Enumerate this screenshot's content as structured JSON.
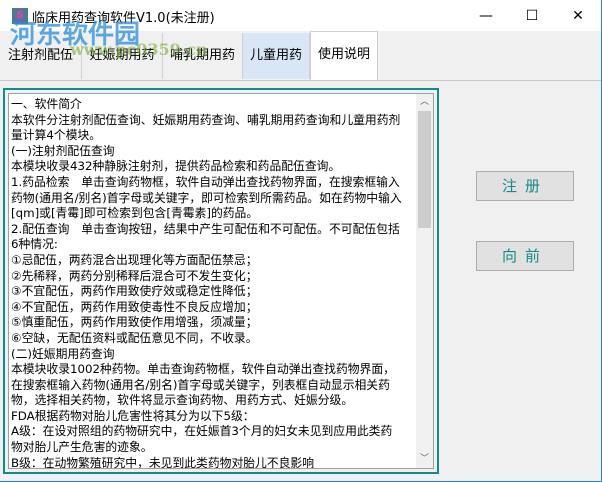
{
  "window": {
    "title": "临床用药查询软件V1.0(未注册)",
    "controls": {
      "minimize": "—",
      "maximize": "☐",
      "close": "✕"
    },
    "icon_letter": "S"
  },
  "tabs": [
    {
      "label": "注射剂配伍"
    },
    {
      "label": "妊娠期用药"
    },
    {
      "label": "哺乳期用药"
    },
    {
      "label": "儿童用药"
    },
    {
      "label": "使用说明"
    }
  ],
  "content": {
    "lines": [
      "一、软件简介",
      "本软件分注射剂配伍查询、妊娠期用药查询、哺乳期用药查询和儿童用药剂",
      "量计算4个模块。",
      "(一)注射剂配伍查询",
      "本模块收录432种静脉注射剂，提供药品检索和药品配伍查询。",
      "1.药品检索　单击查询药物框，软件自动弹出查找药物界面，在搜索框输入",
      "药物(通用名/别名)首字母或关键字，即可检索到所需药品。如在药物中输入",
      "[qm]或[青霉]即可检索到包含[青霉素]的药品。",
      "2.配伍查询　单击查询按钮，结果中产生可配伍和不可配伍。不可配伍包括",
      "6种情况:",
      "①忌配伍，两药混合出现理化等方面配伍禁忌；",
      "②先稀释，两药分别稀释后混合可不发生变化；",
      "③不宜配伍，两药作用致使疗效或稳定性降低；",
      "④不宜配伍，两药作用致使毒性不良反应增加；",
      "⑤慎重配伍，两药作用致使作用增强，须减量；",
      "⑥空缺，无配伍资料或配伍意见不同，不收录。",
      "(二)妊娠期用药查询",
      "本模块收录1002种药物。单击查询药物框，软件自动弹出查找药物界面，",
      "在搜索框输入药物(通用名/别名)首字母或关键字，列表框自动显示相关药",
      "物，选择相关药物，软件将显示查询药物、用药方式、妊娠分级。",
      "FDA根据药物对胎儿危害性将其分为以下5级：",
      "A级：在设对照组的药物研究中，在妊娠首3个月的妇女未见到应用此类药",
      "物对胎儿产生危害的迹象。",
      "B级：在动物繁殖研究中，未见到此类药物对胎儿不良影响"
    ]
  },
  "buttons": {
    "register": "注册",
    "forward": "向前"
  },
  "watermark": {
    "name": "河东软件园",
    "url": "www.pc0359.cn"
  },
  "colors": {
    "accent": "#148a8a",
    "tab_highlight": "#d8e6f5"
  }
}
